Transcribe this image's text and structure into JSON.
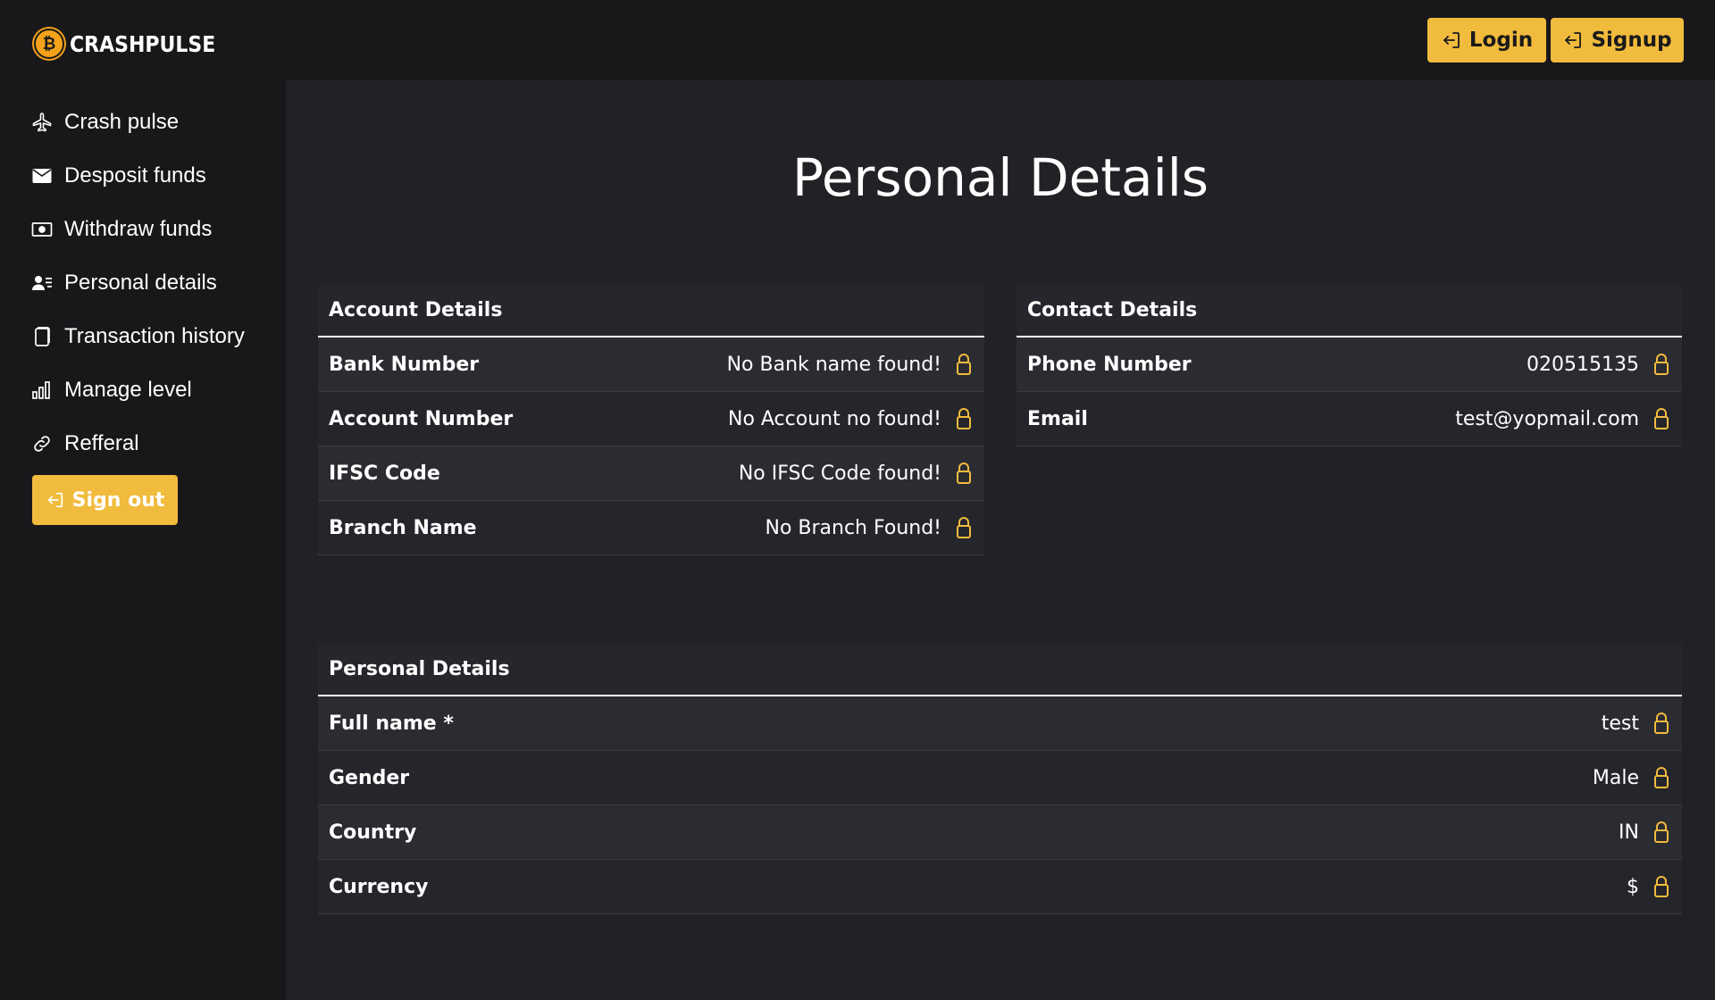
{
  "brand": {
    "name": "CRASHPULSE",
    "coin_symbol": "₿",
    "accent": "#f4a21a"
  },
  "sidebar": {
    "items": [
      {
        "label": "Crash pulse",
        "icon": "airplane-icon"
      },
      {
        "label": "Desposit funds",
        "icon": "envelope-icon"
      },
      {
        "label": "Withdraw funds",
        "icon": "cash-icon"
      },
      {
        "label": "Personal details",
        "icon": "person-lines-icon"
      },
      {
        "label": "Transaction history",
        "icon": "document-icon"
      },
      {
        "label": "Manage level",
        "icon": "bar-chart-icon"
      },
      {
        "label": "Refferal",
        "icon": "link-icon"
      }
    ],
    "signout_label": "Sign out"
  },
  "header": {
    "login_label": "Login",
    "signup_label": "Signup"
  },
  "page": {
    "title": "Personal Details"
  },
  "account": {
    "title": "Account Details",
    "rows": [
      {
        "label": "Bank Number",
        "value": "No Bank name found!"
      },
      {
        "label": "Account Number",
        "value": "No Account no found!"
      },
      {
        "label": "IFSC Code",
        "value": "No IFSC Code found!"
      },
      {
        "label": "Branch Name",
        "value": "No Branch Found!"
      }
    ]
  },
  "contact": {
    "title": "Contact Details",
    "rows": [
      {
        "label": "Phone Number",
        "value": "020515135"
      },
      {
        "label": "Email",
        "value": "test@yopmail.com"
      }
    ]
  },
  "personal": {
    "title": "Personal Details",
    "rows": [
      {
        "label": "Full name *",
        "value": "test"
      },
      {
        "label": "Gender",
        "value": "Male"
      },
      {
        "label": "Country",
        "value": "IN"
      },
      {
        "label": "Currency",
        "value": "$"
      }
    ]
  },
  "colors": {
    "button": "#f1bb3d",
    "lock": "#f1bb3d",
    "background": "#222226",
    "sidebar": "#18181b"
  }
}
